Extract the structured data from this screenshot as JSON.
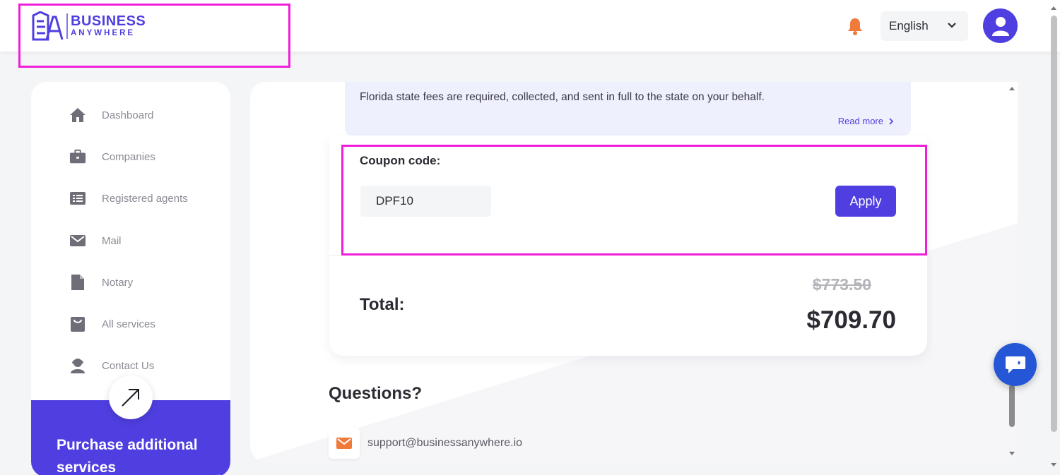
{
  "brand": {
    "line1": "BUSINESS",
    "line2": "ANYWHERE",
    "accent": "#4f3fe0"
  },
  "header": {
    "language": "English",
    "notification_icon": "bell-icon",
    "user_icon": "user-icon"
  },
  "sidebar": {
    "items": [
      {
        "label": "Dashboard",
        "icon": "home-icon"
      },
      {
        "label": "Companies",
        "icon": "briefcase-icon"
      },
      {
        "label": "Registered agents",
        "icon": "list-icon"
      },
      {
        "label": "Mail",
        "icon": "envelope-icon"
      },
      {
        "label": "Notary",
        "icon": "document-icon"
      },
      {
        "label": "All services",
        "icon": "bag-icon"
      },
      {
        "label": "Contact Us",
        "icon": "support-agent-icon"
      }
    ],
    "promo": {
      "title": "Purchase additional services",
      "icon": "arrow-up-right-icon"
    }
  },
  "main": {
    "info": {
      "text": "Florida state fees are required, collected, and sent in full to the state on your behalf.",
      "read_more": "Read more"
    },
    "coupon": {
      "label": "Coupon code:",
      "value": "DPF10",
      "apply": "Apply"
    },
    "total": {
      "label": "Total:",
      "old_price": "$773.50",
      "new_price": "$709.70"
    },
    "questions": {
      "title": "Questions?",
      "email": "support@businessanywhere.io"
    }
  },
  "colors": {
    "highlight": "#f01dd9",
    "bell": "#f07a3a",
    "chat": "#2456d6"
  }
}
